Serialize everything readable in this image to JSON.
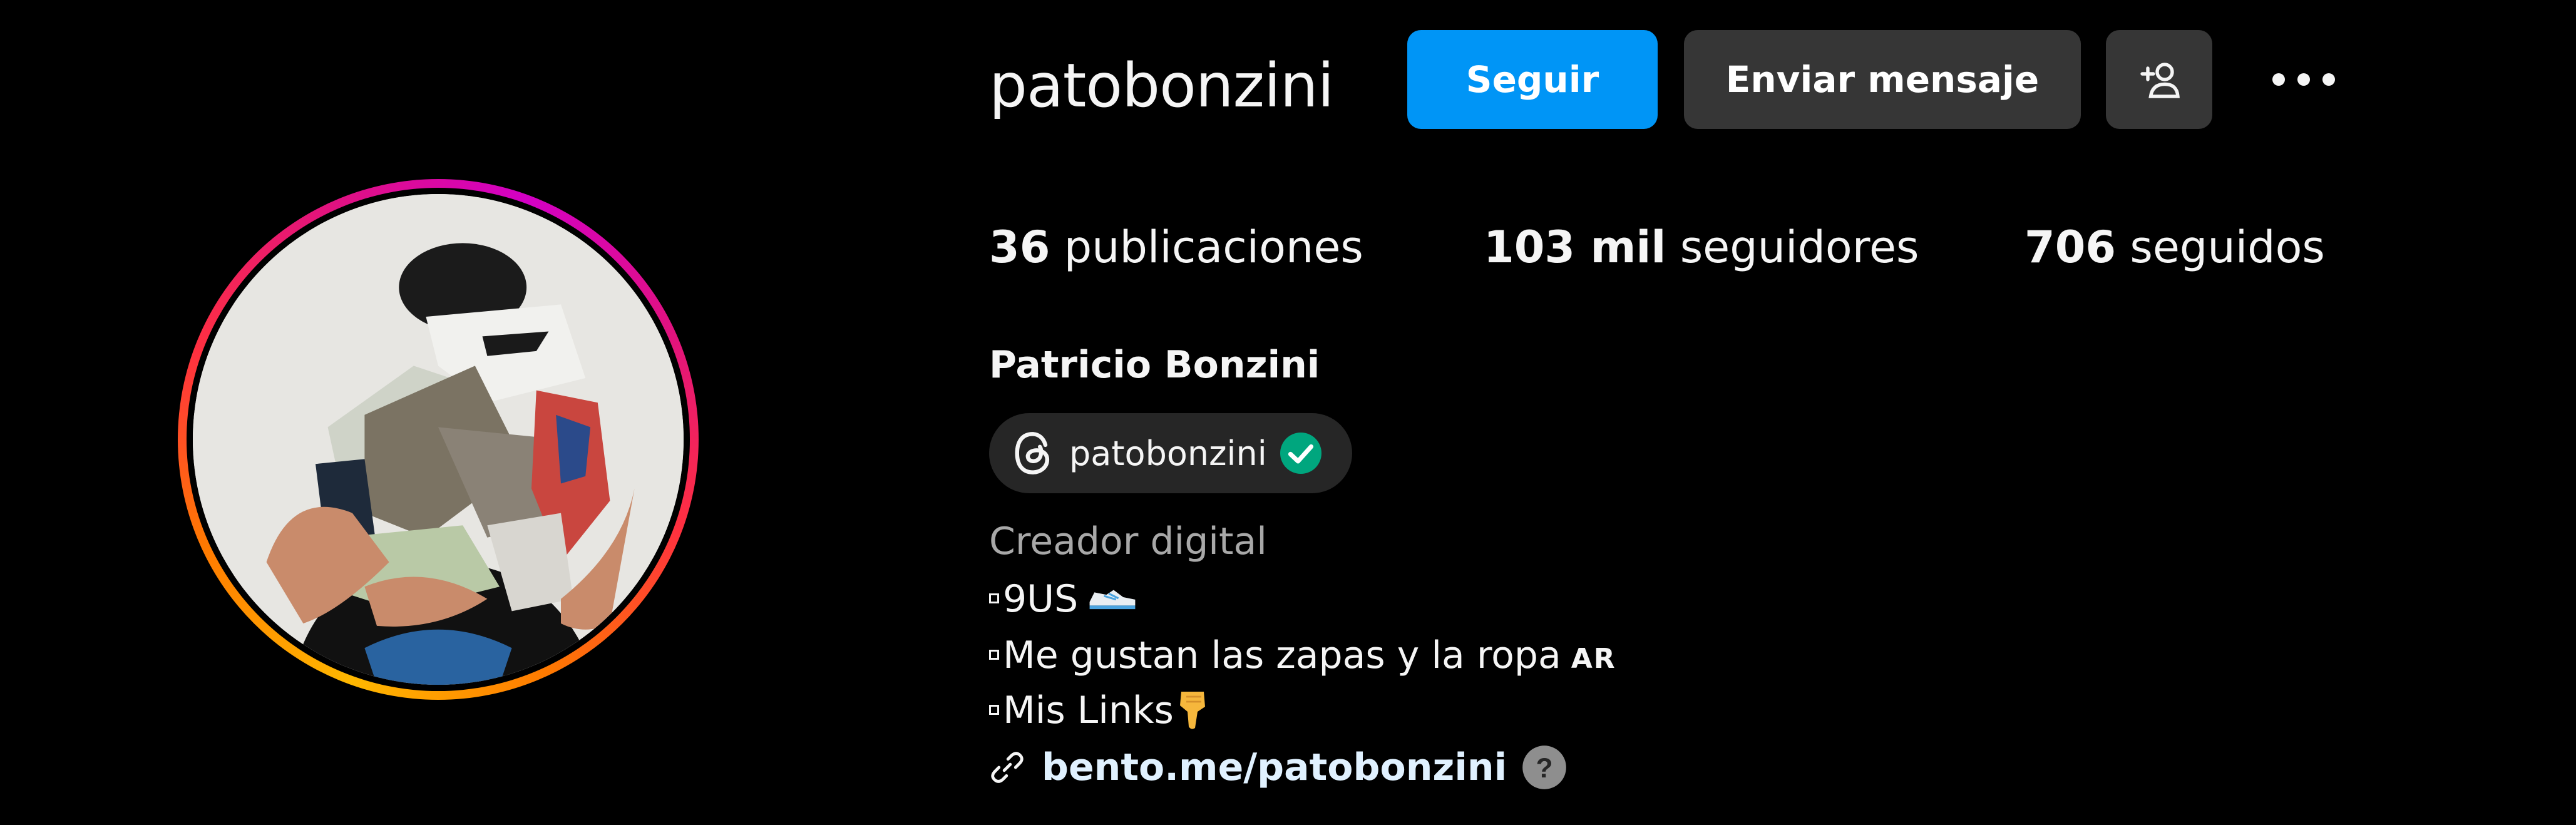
{
  "profile": {
    "username": "patobonzini",
    "full_name": "Patricio Bonzini"
  },
  "actions": {
    "follow_label": "Seguir",
    "message_label": "Enviar mensaje",
    "add_user_icon": "add-person-icon",
    "more_icon": "more-horizontal-icon"
  },
  "stats": {
    "posts_count": "36",
    "posts_label": "publicaciones",
    "followers_count": "103 mil",
    "followers_label": "seguidores",
    "following_count": "706",
    "following_label": "seguidos"
  },
  "threads": {
    "handle": "patobonzini",
    "icon": "threads-icon",
    "verified_icon": "verified-check-icon"
  },
  "bio": {
    "category": "Creador digital",
    "line1": "9US",
    "line1_emoji": "running-shoe-emoji",
    "line2": "Me gustan las zapas y la ropa",
    "line2_flag": "AR",
    "line3": "Mis Links",
    "line3_emoji": "backhand-index-pointing-down-emoji"
  },
  "link": {
    "url_text": "bento.me/patobonzini",
    "icon": "link-icon",
    "help_icon": "question-icon"
  },
  "colors": {
    "background": "#000000",
    "primary_button": "#0095f6",
    "secondary_button": "#363636",
    "pill": "#262626",
    "category_text": "#a8a8a8",
    "link_text": "#e0f1ff",
    "verified": "#00a67e"
  }
}
